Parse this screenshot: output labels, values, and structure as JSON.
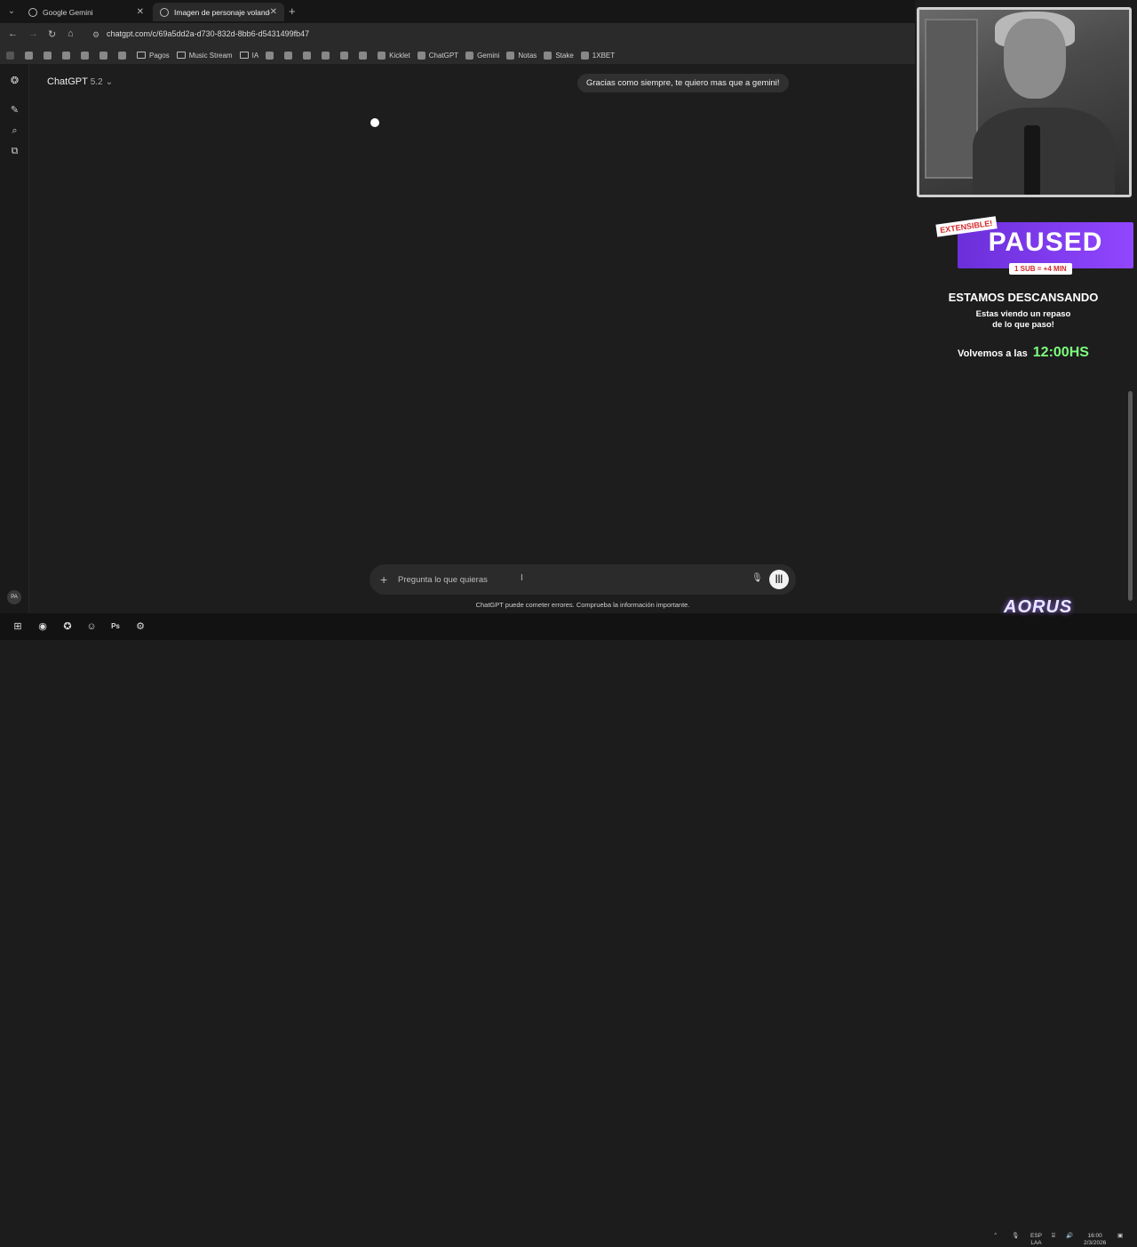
{
  "browser": {
    "tabs": [
      {
        "label": "Google Gemini"
      },
      {
        "label": "Imagen de personaje volando"
      }
    ],
    "url": "chatgpt.com/c/69a5dd2a-d730-832d-8bb6-d5431499fb47",
    "bookmarks": [
      "Pagos",
      "Music Stream",
      "IA",
      "Kicklet",
      "ChatGPT",
      "Gemini",
      "Notas",
      "Stake",
      "1XBET"
    ]
  },
  "chat": {
    "model_name": "ChatGPT",
    "model_version": "5.2",
    "user_message": "Gracias como siempre, te quiero mas que a gemini!",
    "composer_placeholder": "Pregunta lo que quieras",
    "disclaimer": "ChatGPT puede cometer errores. Comprueba la información importante.",
    "avatar_initials": "PA"
  },
  "stream_overlay": {
    "tag": "EXTENSIBLE!",
    "status": "PAUSED",
    "sub_info": "1 SUB = +4 MIN",
    "heading": "ESTAMOS DESCANSANDO",
    "line1": "Estas viendo un repaso",
    "line2": "de lo que paso!",
    "return_label": "Volvemos a las",
    "return_time": "12:00HS",
    "time_color": "#7dff7d",
    "accent_color": "#9146ff"
  },
  "taskbar": {
    "brand": "AORUS",
    "lang_line1": "ESP",
    "lang_line2": "LAA",
    "clock_time": "16:00",
    "clock_date": "2/3/2026"
  }
}
